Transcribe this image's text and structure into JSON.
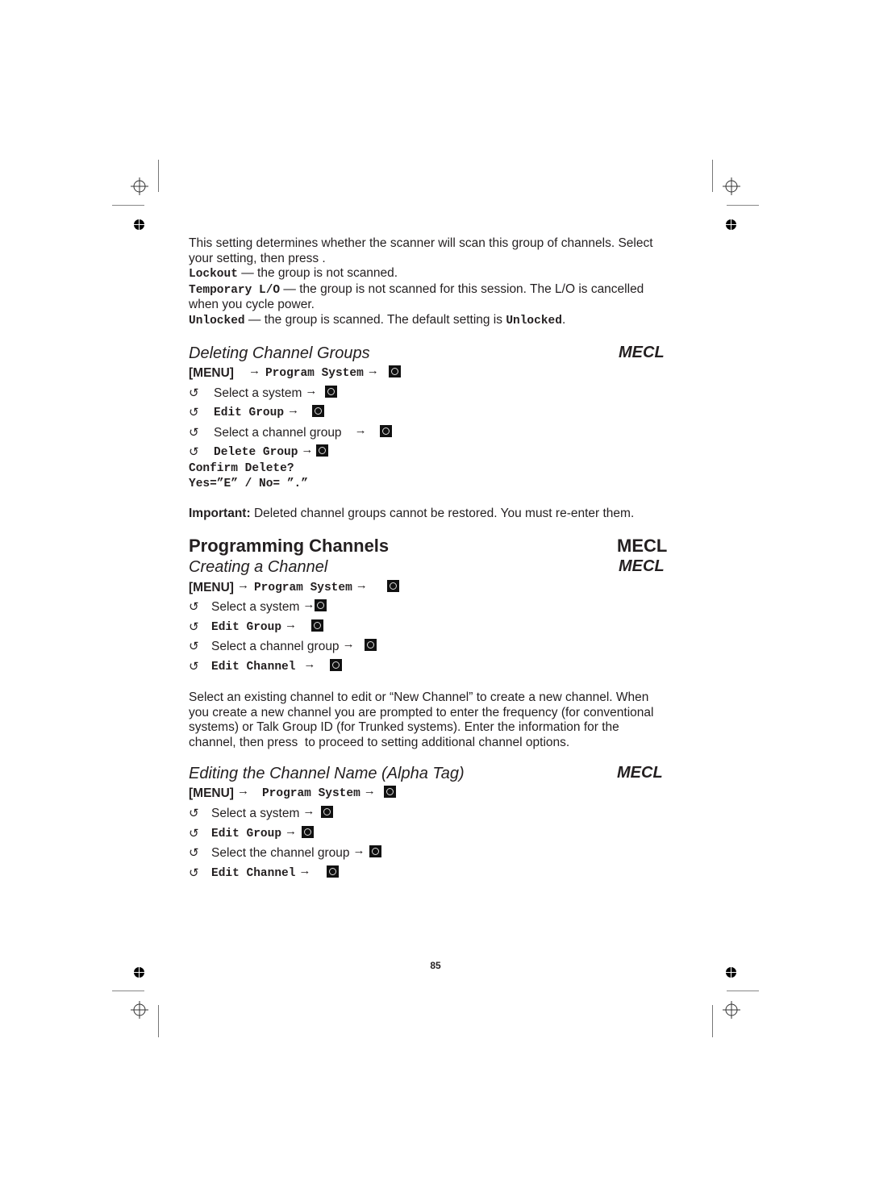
{
  "intro": {
    "line1": "This setting determines whether the scanner will scan this group of channels. Select",
    "line2": "your setting, then press .",
    "options": [
      {
        "code": "Lockout",
        "desc": " — the group is not scanned."
      },
      {
        "code": "Temporary L/O",
        "desc": " — the group is not scanned for this session. The L/O is cancelled"
      },
      {
        "cont": "when you cycle power."
      },
      {
        "code": "Unlocked",
        "desc": " — the group is scanned. The default setting is ",
        "code2": "Unlocked",
        "tail": "."
      }
    ]
  },
  "sections": {
    "deleting": {
      "title": "Deleting Channel Groups",
      "tag": "MECL",
      "menu": {
        "key": "[MENU]",
        "item": "Program System"
      },
      "steps": [
        {
          "text": "Select a system",
          "mono": false
        },
        {
          "text": "Edit Group",
          "mono": true
        },
        {
          "text": "Select a channel group",
          "mono": false
        },
        {
          "text": "Delete Group",
          "mono": true
        }
      ],
      "confirm_line1": "Confirm Delete?",
      "confirm_line2": "Yes=”E” / No= ”.”",
      "important_label": "Important:",
      "important_text": " Deleted channel groups cannot be restored. You must re-enter them."
    },
    "programming": {
      "title": "Programming Channels",
      "tag": "MECL"
    },
    "creating": {
      "title": "Creating a Channel",
      "tag": "MECL",
      "menu": {
        "key": "[MENU]",
        "item": "Program System"
      },
      "steps": [
        {
          "text": "Select a system",
          "mono": false
        },
        {
          "text": "Edit Group",
          "mono": true
        },
        {
          "text": "Select a channel group",
          "mono": false
        },
        {
          "text": "Edit Channel",
          "mono": true
        }
      ],
      "body": [
        "Select an existing channel to edit or “New Channel” to create a new channel. When",
        "you create a new channel you are prompted to enter the frequency (for conventional",
        "systems) or Talk Group ID (for Trunked systems). Enter the information for the",
        "channel, then press  to proceed to setting additional channel options."
      ]
    },
    "editing": {
      "title": "Editing the Channel Name (Alpha Tag)",
      "tag": "MECL",
      "menu": {
        "key": "[MENU]",
        "item": "Program System"
      },
      "steps": [
        {
          "text": "Select a system",
          "mono": false
        },
        {
          "text": "Edit Group",
          "mono": true
        },
        {
          "text": "Select the channel group",
          "mono": false
        },
        {
          "text": "Edit Channel",
          "mono": true
        }
      ]
    }
  },
  "icons": {
    "arrow": "→",
    "rotate": "↺"
  },
  "page_number": "85"
}
